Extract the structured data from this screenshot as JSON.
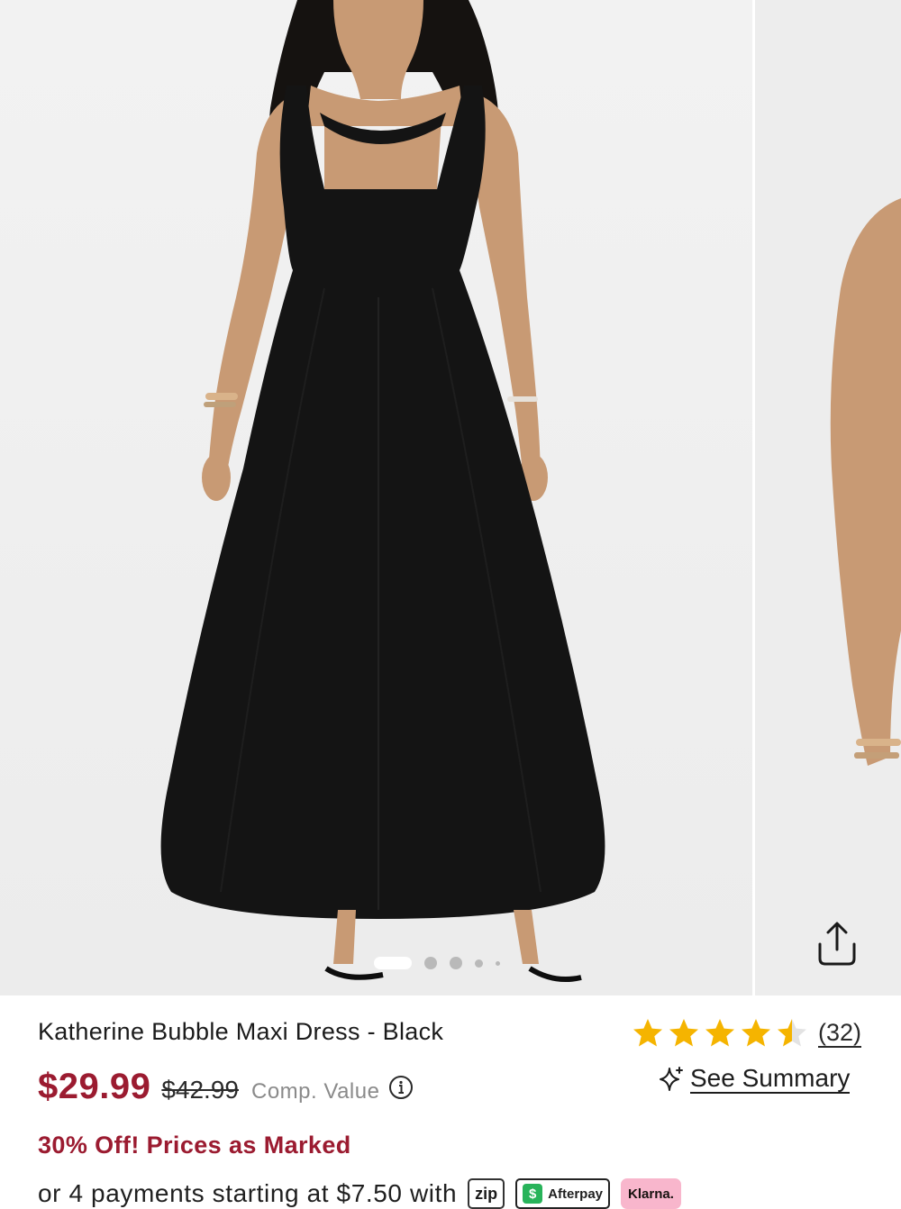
{
  "product": {
    "title": "Katherine Bubble Maxi Dress - Black",
    "price": "$29.99",
    "original_price": "$42.99",
    "comp_value_label": "Comp. Value",
    "promo": "30% Off! Prices as Marked",
    "payments_text": "or 4 payments starting at $7.50 with"
  },
  "rating": {
    "stars": 4.5,
    "max_stars": 5,
    "review_count": "(32)",
    "star_color": "#f5b400",
    "empty_star_color": "#e3e3e3"
  },
  "summary": {
    "label": "See Summary",
    "icon": "sparkle-icon"
  },
  "gallery": {
    "active_index": 0,
    "dot_count": 5,
    "share_icon": "share-icon",
    "dress_color": "#141414",
    "skin_color": "#c89a74",
    "background_color": "#eeeeee"
  },
  "payment_providers": [
    {
      "name": "zip",
      "label": "zip"
    },
    {
      "name": "afterpay",
      "label": "Afterpay"
    },
    {
      "name": "klarna",
      "label": "Klarna."
    }
  ],
  "colors": {
    "price": "#9b1b30",
    "promo": "#9b1b30",
    "klarna_pink": "#f8b6cc",
    "afterpay_green": "#28b35a"
  }
}
